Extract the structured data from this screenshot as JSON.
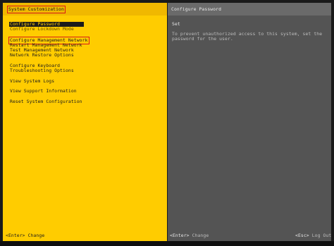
{
  "left": {
    "title": "System Customization",
    "menu": [
      {
        "label": "Configure Password"
      },
      {
        "label": "Configure Lockdown Mode"
      },
      {
        "label": "Configure Management Network"
      },
      {
        "label": "Restart Management Network"
      },
      {
        "label": "Test Management Network"
      },
      {
        "label": "Network Restore Options"
      },
      {
        "label": "Configure Keyboard"
      },
      {
        "label": "Troubleshooting Options"
      },
      {
        "label": "View System Logs"
      },
      {
        "label": "View Support Information"
      },
      {
        "label": "Reset System Configuration"
      }
    ]
  },
  "right": {
    "title": "Configure Password",
    "status": "Set",
    "description_line1": "To prevent unauthorized access to this system, set the",
    "description_line2": "password for the user."
  },
  "footer": {
    "left_key": "<Enter>",
    "left_action": "Change",
    "right_key": "<Esc>",
    "right_action": "Log Out"
  },
  "colors": {
    "left_panel": "#ffcc00",
    "right_panel": "#545454",
    "highlight_box": "#d81818"
  }
}
